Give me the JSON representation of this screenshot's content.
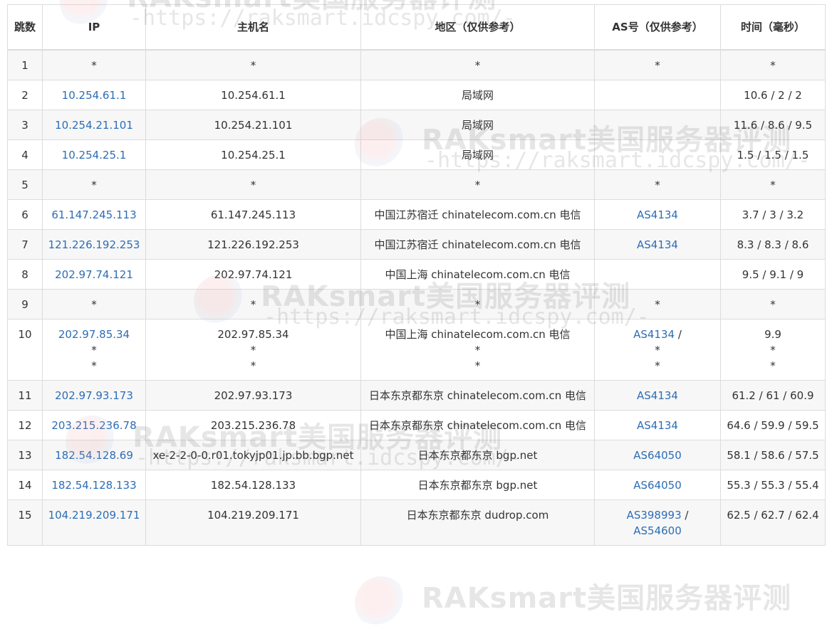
{
  "watermark": {
    "title": "RAKsmart美国服务器评测",
    "url": "-https://raksmart.idcspy.com/-"
  },
  "headers": {
    "hop": "跳数",
    "ip": "IP",
    "host": "主机名",
    "region": "地区（仅供参考）",
    "as": "AS号（仅供参考）",
    "time": "时间（毫秒）"
  },
  "rows": [
    {
      "hop": "1",
      "ip": [
        "*"
      ],
      "host": [
        "*"
      ],
      "region": [
        "*"
      ],
      "as": [
        "*"
      ],
      "time": [
        "*"
      ]
    },
    {
      "hop": "2",
      "ip": [
        "10.254.61.1"
      ],
      "host": [
        "10.254.61.1"
      ],
      "region": [
        "局域网"
      ],
      "as": [],
      "time": [
        "10.6 / 2 / 2"
      ]
    },
    {
      "hop": "3",
      "ip": [
        "10.254.21.101"
      ],
      "host": [
        "10.254.21.101"
      ],
      "region": [
        "局域网"
      ],
      "as": [],
      "time": [
        "11.6 / 8.6 / 9.5"
      ]
    },
    {
      "hop": "4",
      "ip": [
        "10.254.25.1"
      ],
      "host": [
        "10.254.25.1"
      ],
      "region": [
        "局域网"
      ],
      "as": [],
      "time": [
        "1.5 / 1.5 / 1.5"
      ]
    },
    {
      "hop": "5",
      "ip": [
        "*"
      ],
      "host": [
        "*"
      ],
      "region": [
        "*"
      ],
      "as": [
        "*"
      ],
      "time": [
        "*"
      ]
    },
    {
      "hop": "6",
      "ip": [
        "61.147.245.113"
      ],
      "host": [
        "61.147.245.113"
      ],
      "region": [
        "中国江苏宿迁 chinatelecom.com.cn 电信"
      ],
      "as": [
        "AS4134"
      ],
      "time": [
        "3.7 / 3 / 3.2"
      ]
    },
    {
      "hop": "7",
      "ip": [
        "121.226.192.253"
      ],
      "host": [
        "121.226.192.253"
      ],
      "region": [
        "中国江苏宿迁 chinatelecom.com.cn 电信"
      ],
      "as": [
        "AS4134"
      ],
      "time": [
        "8.3 / 8.3 / 8.6"
      ]
    },
    {
      "hop": "8",
      "ip": [
        "202.97.74.121"
      ],
      "host": [
        "202.97.74.121"
      ],
      "region": [
        "中国上海 chinatelecom.com.cn 电信"
      ],
      "as": [],
      "time": [
        "9.5 / 9.1 / 9"
      ]
    },
    {
      "hop": "9",
      "ip": [
        "*"
      ],
      "host": [
        "*"
      ],
      "region": [
        "*"
      ],
      "as": [
        "*"
      ],
      "time": [
        "*"
      ]
    },
    {
      "hop": "10",
      "ip": [
        "202.97.85.34",
        "*",
        "*"
      ],
      "host": [
        "202.97.85.34",
        "*",
        "*"
      ],
      "region": [
        "中国上海 chinatelecom.com.cn 电信",
        "*",
        "*"
      ],
      "as": [
        "AS4134",
        "*",
        "*"
      ],
      "time": [
        "9.9",
        "*",
        "*"
      ]
    },
    {
      "hop": "11",
      "ip": [
        "202.97.93.173"
      ],
      "host": [
        "202.97.93.173"
      ],
      "region": [
        "日本东京都东京 chinatelecom.com.cn 电信"
      ],
      "as": [
        "AS4134"
      ],
      "time": [
        "61.2 / 61 / 60.9"
      ]
    },
    {
      "hop": "12",
      "ip": [
        "203.215.236.78"
      ],
      "host": [
        "203.215.236.78"
      ],
      "region": [
        "日本东京都东京 chinatelecom.com.cn 电信"
      ],
      "as": [
        "AS4134"
      ],
      "time": [
        "64.6 / 59.9 / 59.5"
      ]
    },
    {
      "hop": "13",
      "ip": [
        "182.54.128.69"
      ],
      "host": [
        "xe-2-2-0-0.r01.tokyjp01.jp.bb.bgp.net"
      ],
      "region": [
        "日本东京都东京 bgp.net"
      ],
      "as": [
        "AS64050"
      ],
      "time": [
        "58.1 / 58.6 / 57.5"
      ]
    },
    {
      "hop": "14",
      "ip": [
        "182.54.128.133"
      ],
      "host": [
        "182.54.128.133"
      ],
      "region": [
        "日本东京都东京 bgp.net"
      ],
      "as": [
        "AS64050"
      ],
      "time": [
        "55.3 / 55.3 / 55.4"
      ]
    },
    {
      "hop": "15",
      "ip": [
        "104.219.209.171"
      ],
      "host": [
        "104.219.209.171"
      ],
      "region": [
        "日本东京都东京 dudrop.com"
      ],
      "as": [
        "AS398993",
        "AS54600"
      ],
      "time": [
        "62.5 / 62.7 / 62.4"
      ]
    }
  ]
}
